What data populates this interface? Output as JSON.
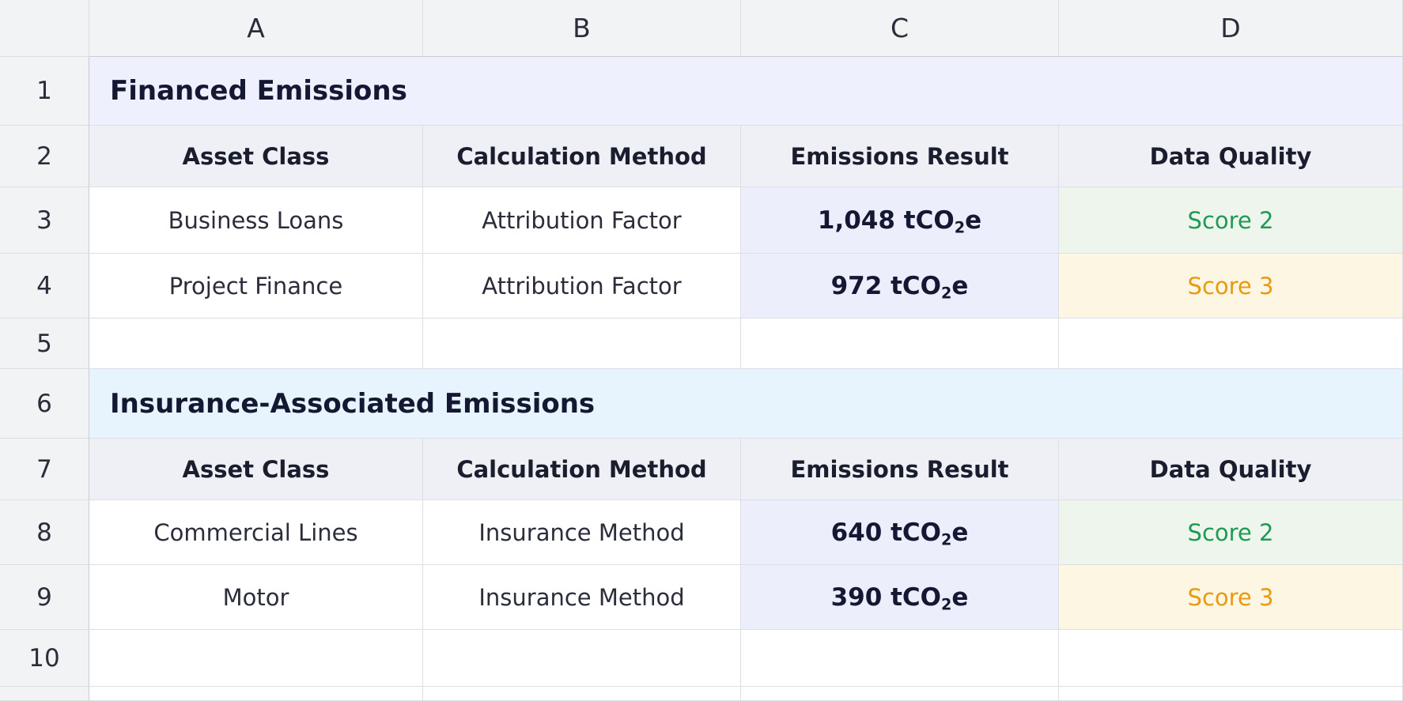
{
  "columns": [
    "A",
    "B",
    "C",
    "D"
  ],
  "rows": [
    "1",
    "2",
    "3",
    "4",
    "5",
    "6",
    "7",
    "8",
    "9",
    "10"
  ],
  "financed": {
    "title": "Financed Emissions",
    "headers": [
      "Asset Class",
      "Calculation Method",
      "Emissions Result",
      "Data Quality"
    ],
    "rows": [
      {
        "asset_class": "Business Loans",
        "method": "Attribution Factor",
        "value": "1,048",
        "unit_pre": "tCO",
        "unit_sub": "2",
        "unit_post": "e",
        "quality": "Score 2"
      },
      {
        "asset_class": "Project Finance",
        "method": "Attribution Factor",
        "value": "972",
        "unit_pre": "tCO",
        "unit_sub": "2",
        "unit_post": "e",
        "quality": "Score 3"
      }
    ]
  },
  "insurance": {
    "title": "Insurance-Associated Emissions",
    "headers": [
      "Asset Class",
      "Calculation Method",
      "Emissions Result",
      "Data Quality"
    ],
    "rows": [
      {
        "asset_class": "Commercial Lines",
        "method": "Insurance Method",
        "value": "640",
        "unit_pre": "tCO",
        "unit_sub": "2",
        "unit_post": "e",
        "quality": "Score 2"
      },
      {
        "asset_class": "Motor",
        "method": "Insurance Method",
        "value": "390",
        "unit_pre": "tCO",
        "unit_sub": "2",
        "unit_post": "e",
        "quality": "Score 3"
      }
    ]
  },
  "colors": {
    "score_2": "#1f9a55",
    "score_3": "#e89a10",
    "financed_title_bg": "#eef0fd",
    "insurance_title_bg": "#e8f4fd"
  }
}
